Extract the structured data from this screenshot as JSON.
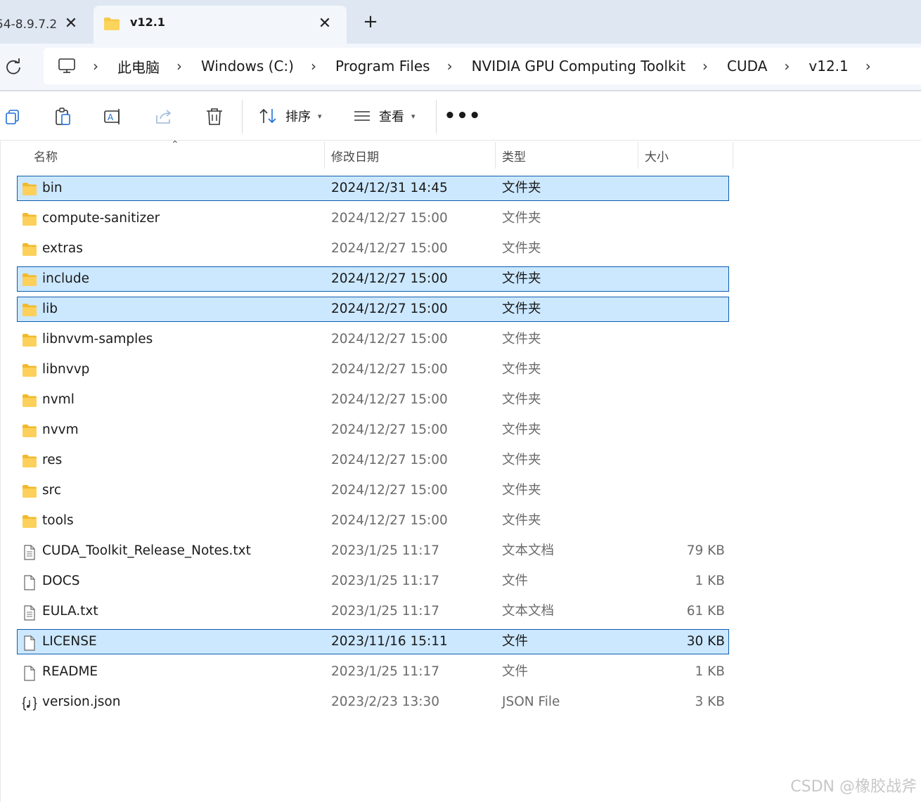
{
  "tabs": [
    {
      "title": "54-8.9.7.2",
      "active": false
    },
    {
      "title": "v12.1",
      "active": true
    }
  ],
  "new_tab_label": "+",
  "breadcrumb": [
    "此电脑",
    "Windows (C:)",
    "Program Files",
    "NVIDIA GPU Computing Toolkit",
    "CUDA",
    "v12.1"
  ],
  "toolbar": {
    "sort_label": "排序",
    "view_label": "查看",
    "more_label": "•••"
  },
  "columns": {
    "name": "名称",
    "date": "修改日期",
    "type": "类型",
    "size": "大小"
  },
  "files": [
    {
      "name": "bin",
      "date": "2024/12/31 14:45",
      "type": "文件夹",
      "size": "",
      "icon": "folder-icon",
      "selected": true
    },
    {
      "name": "compute-sanitizer",
      "date": "2024/12/27 15:00",
      "type": "文件夹",
      "size": "",
      "icon": "folder-icon",
      "selected": false
    },
    {
      "name": "extras",
      "date": "2024/12/27 15:00",
      "type": "文件夹",
      "size": "",
      "icon": "folder-icon",
      "selected": false
    },
    {
      "name": "include",
      "date": "2024/12/27 15:00",
      "type": "文件夹",
      "size": "",
      "icon": "folder-icon",
      "selected": true
    },
    {
      "name": "lib",
      "date": "2024/12/27 15:00",
      "type": "文件夹",
      "size": "",
      "icon": "folder-icon",
      "selected": true
    },
    {
      "name": "libnvvm-samples",
      "date": "2024/12/27 15:00",
      "type": "文件夹",
      "size": "",
      "icon": "folder-icon",
      "selected": false
    },
    {
      "name": "libnvvp",
      "date": "2024/12/27 15:00",
      "type": "文件夹",
      "size": "",
      "icon": "folder-icon",
      "selected": false
    },
    {
      "name": "nvml",
      "date": "2024/12/27 15:00",
      "type": "文件夹",
      "size": "",
      "icon": "folder-icon",
      "selected": false
    },
    {
      "name": "nvvm",
      "date": "2024/12/27 15:00",
      "type": "文件夹",
      "size": "",
      "icon": "folder-icon",
      "selected": false
    },
    {
      "name": "res",
      "date": "2024/12/27 15:00",
      "type": "文件夹",
      "size": "",
      "icon": "folder-icon",
      "selected": false
    },
    {
      "name": "src",
      "date": "2024/12/27 15:00",
      "type": "文件夹",
      "size": "",
      "icon": "folder-icon",
      "selected": false
    },
    {
      "name": "tools",
      "date": "2024/12/27 15:00",
      "type": "文件夹",
      "size": "",
      "icon": "folder-icon",
      "selected": false
    },
    {
      "name": "CUDA_Toolkit_Release_Notes.txt",
      "date": "2023/1/25 11:17",
      "type": "文本文档",
      "size": "79 KB",
      "icon": "text-file-icon",
      "selected": false
    },
    {
      "name": "DOCS",
      "date": "2023/1/25 11:17",
      "type": "文件",
      "size": "1 KB",
      "icon": "file-icon",
      "selected": false
    },
    {
      "name": "EULA.txt",
      "date": "2023/1/25 11:17",
      "type": "文本文档",
      "size": "61 KB",
      "icon": "text-file-icon",
      "selected": false
    },
    {
      "name": "LICENSE",
      "date": "2023/11/16 15:11",
      "type": "文件",
      "size": "30 KB",
      "icon": "file-icon",
      "selected": true
    },
    {
      "name": "README",
      "date": "2023/1/25 11:17",
      "type": "文件",
      "size": "1 KB",
      "icon": "file-icon",
      "selected": false
    },
    {
      "name": "version.json",
      "date": "2023/2/23 13:30",
      "type": "JSON File",
      "size": "3 KB",
      "icon": "json-file-icon",
      "selected": false
    }
  ],
  "watermark": "CSDN @橡胶战斧",
  "colors": {
    "tabstrip_bg": "#dfe7f2",
    "selection_bg": "#cce8ff",
    "selection_border": "#0b5cad",
    "folder_yellow": "#f7c948"
  }
}
